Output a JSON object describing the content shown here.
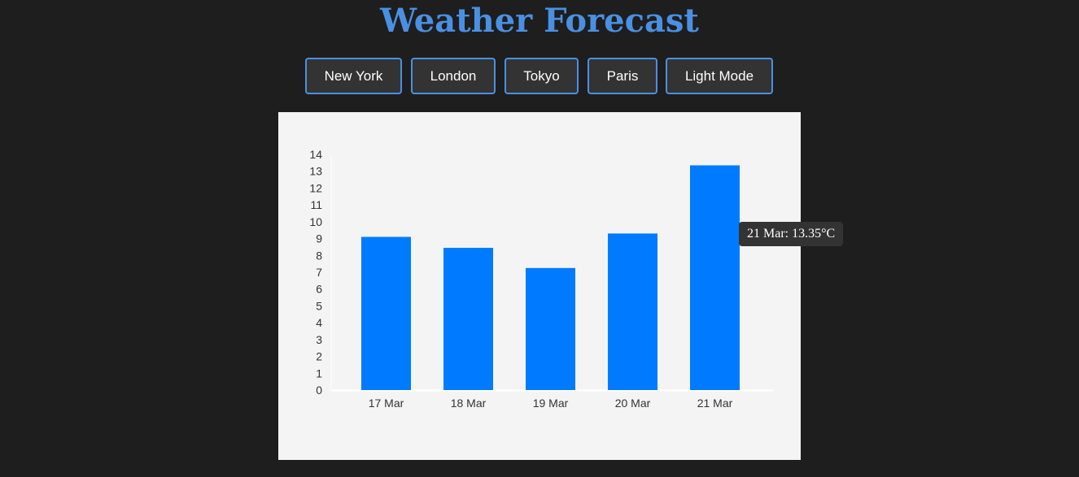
{
  "page": {
    "title": "Weather Forecast"
  },
  "buttons": {
    "new_york": "New York",
    "london": "London",
    "tokyo": "Tokyo",
    "paris": "Paris",
    "theme_toggle": "Light Mode"
  },
  "tooltip": {
    "text": "21 Mar: 13.35°C"
  },
  "colors": {
    "accent": "#4a90e2",
    "bar": "#007bff",
    "background": "#1e1e1e",
    "chart_background": "#f4f4f4"
  },
  "chart_data": {
    "type": "bar",
    "title": "",
    "xlabel": "",
    "ylabel": "",
    "categories": [
      "17 Mar",
      "18 Mar",
      "19 Mar",
      "20 Mar",
      "21 Mar"
    ],
    "values": [
      9.1,
      8.45,
      7.25,
      9.3,
      13.35
    ],
    "ylim": [
      0,
      14
    ],
    "yticks": [
      0,
      1,
      2,
      3,
      4,
      5,
      6,
      7,
      8,
      9,
      10,
      11,
      12,
      13,
      14
    ],
    "grid": false,
    "legend": "none"
  }
}
